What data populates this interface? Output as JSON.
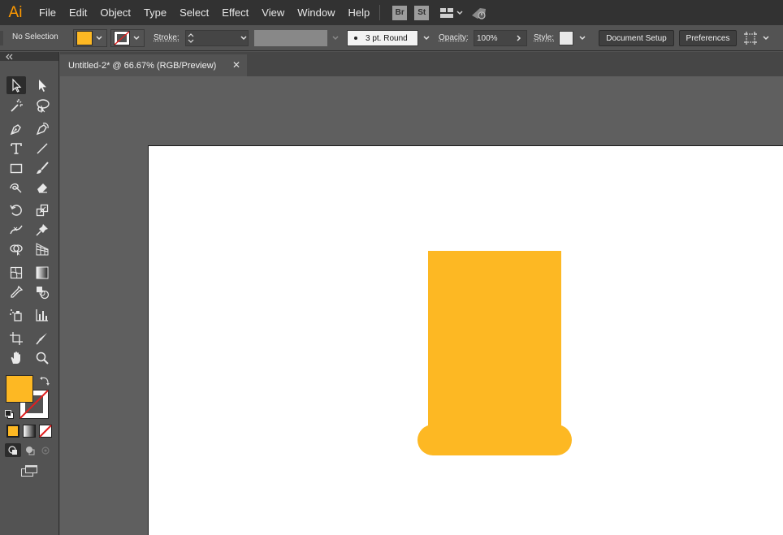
{
  "app": {
    "logo_text": "Ai",
    "menu": [
      "File",
      "Edit",
      "Object",
      "Type",
      "Select",
      "Effect",
      "View",
      "Window",
      "Help"
    ],
    "badges": [
      "Br",
      "St"
    ]
  },
  "control_bar": {
    "selection_label": "No Selection",
    "fill_color": "#FDB823",
    "stroke_label": "Stroke:",
    "stroke_value": "",
    "brush_value": "3 pt. Round",
    "opacity_label": "Opacity:",
    "opacity_value": "100%",
    "style_label": "Style:",
    "document_setup": "Document Setup",
    "preferences": "Preferences"
  },
  "document": {
    "tab_title": "Untitled-2* @ 66.67% (RGB/Preview)",
    "close_glyph": "✕"
  },
  "tools": {
    "fill_color": "#FDB823",
    "stroke_color": "none"
  },
  "artwork": {
    "shape_color": "#FDB823"
  }
}
